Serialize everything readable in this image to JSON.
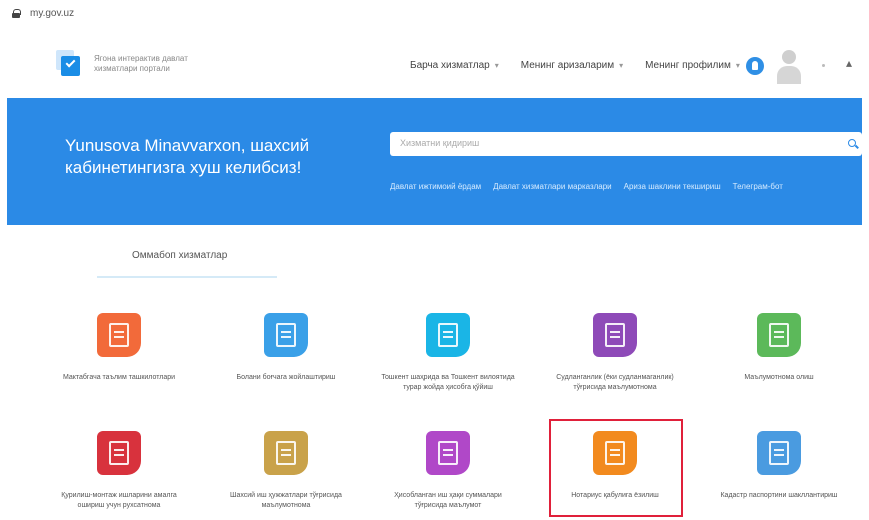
{
  "browser": {
    "url": "my.gov.uz"
  },
  "header": {
    "brand_line1": "Ягона интерактив давлат",
    "brand_line2": "хизматлари портали",
    "nav": [
      {
        "label": "Барча хизматлар"
      },
      {
        "label": "Менинг аризаларим"
      },
      {
        "label": "Менинг профилим"
      }
    ]
  },
  "banner": {
    "welcome_line1": "Yunusova Minavvarxon, шахсий",
    "welcome_line2": "кабинетингизга хуш келибсиз!",
    "search_placeholder": "Хизматни қидириш",
    "quick_links": [
      "Давлат ижтимоий ёрдам",
      "Давлат хизматлари марказлари",
      "Ариза шаклини текшириш",
      "Телеграм-бот"
    ]
  },
  "tabs": {
    "active": "Оммабоп хизматлар"
  },
  "services": [
    {
      "label": "Мактабгача таълим ташкилотлари",
      "color": "#f26a3a"
    },
    {
      "label": "Болани боғчага жойлаштириш",
      "color": "#3aa0e8"
    },
    {
      "label": "Тошкент шаҳрида ва Тошкент вилоятида турар жойда ҳисобга қўйиш",
      "color": "#1ab5e6"
    },
    {
      "label": "Судланганлик (ёки судланмаганлик) тўғрисида маълумотнома",
      "color": "#8e4ab8"
    },
    {
      "label": "Маълумотнома олиш",
      "color": "#5cb95a"
    },
    {
      "label": "Қурилиш-монтаж ишларини амалга ошириш учун рухсатнома",
      "color": "#d8323d"
    },
    {
      "label": "Шахсий иш ҳужжатлари тўғрисида маълумотнома",
      "color": "#c9a24a"
    },
    {
      "label": "Ҳисобланган иш ҳақи суммалари тўғрисида маълумот",
      "color": "#b048c8"
    },
    {
      "label": "Нотариус қабулига ёзилиш",
      "color": "#f28a1e"
    },
    {
      "label": "Кадастр паспортини шакллантириш",
      "color": "#4a9be0"
    }
  ]
}
